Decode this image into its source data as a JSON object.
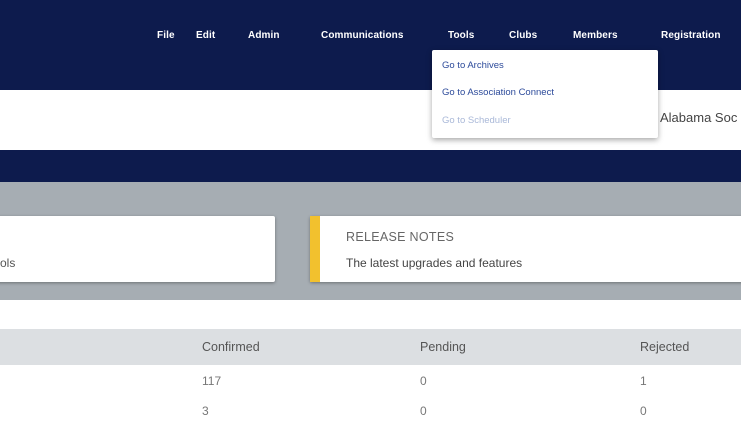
{
  "topnav": {
    "items": [
      "File",
      "Edit",
      "Admin",
      "Communications",
      "Tools",
      "Clubs",
      "Members",
      "Registration"
    ]
  },
  "tools_menu": {
    "items": [
      "Go to Archives",
      "Go to Association Connect",
      "Go to Scheduler"
    ]
  },
  "header": {
    "org_name_partial": "Alabama Soc"
  },
  "cards": {
    "left_partial_text": "ols",
    "release_notes_title": "RELEASE NOTES",
    "release_notes_subtitle": "The latest upgrades and features"
  },
  "table": {
    "headers": [
      "Confirmed",
      "Pending",
      "Rejected"
    ],
    "rows": [
      [
        "117",
        "0",
        "1"
      ],
      [
        "3",
        "0",
        "0"
      ]
    ]
  },
  "colors": {
    "navy": "#0d1b4d",
    "gray_band": "#a6adb3",
    "accent": "#f2c12e",
    "link": "#2c4a9a"
  }
}
